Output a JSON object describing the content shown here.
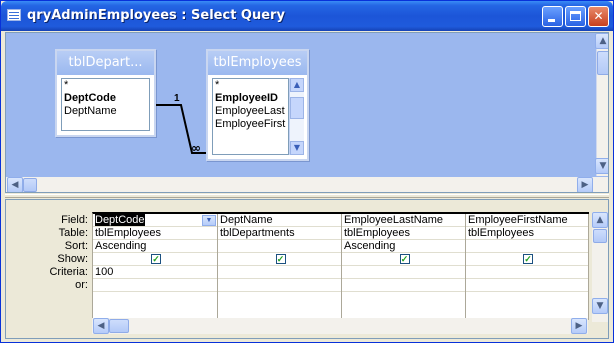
{
  "window": {
    "title": "qryAdminEmployees : Select Query"
  },
  "title_buttons": {
    "minimize": "minimize-icon",
    "maximize": "maximize-icon",
    "close": "close-icon",
    "close_glyph": "✕"
  },
  "tables": [
    {
      "name": "tblDepart...",
      "fields": [
        {
          "label": "*",
          "bold": false
        },
        {
          "label": "DeptCode",
          "bold": true
        },
        {
          "label": "DeptName",
          "bold": false
        }
      ]
    },
    {
      "name": "tblEmployees",
      "fields": [
        {
          "label": "*",
          "bold": false
        },
        {
          "label": "EmployeeID",
          "bold": true
        },
        {
          "label": "EmployeeLast",
          "bold": false
        },
        {
          "label": "EmployeeFirst",
          "bold": false
        }
      ]
    }
  ],
  "relationship": {
    "one_label": "1",
    "many_label": "∞"
  },
  "grid": {
    "row_labels": [
      "Field:",
      "Table:",
      "Sort:",
      "Show:",
      "Criteria:",
      "or:"
    ],
    "columns": [
      {
        "field": "DeptCode",
        "table": "tblEmployees",
        "sort": "Ascending",
        "show": true,
        "criteria": "100",
        "selected": true
      },
      {
        "field": "DeptName",
        "table": "tblDepartments",
        "sort": "",
        "show": true,
        "criteria": ""
      },
      {
        "field": "EmployeeLastName",
        "table": "tblEmployees",
        "sort": "Ascending",
        "show": true,
        "criteria": ""
      },
      {
        "field": "EmployeeFirstName",
        "table": "tblEmployees",
        "sort": "",
        "show": true,
        "criteria": ""
      }
    ]
  },
  "icons": {
    "up": "▲",
    "down": "▼",
    "left": "◀",
    "right": "▶",
    "check": "✓",
    "dropdown": "▼"
  },
  "colors": {
    "title_bar": "#1f5bdc",
    "design_area": "#9bb7ee",
    "check": "#21a121"
  }
}
